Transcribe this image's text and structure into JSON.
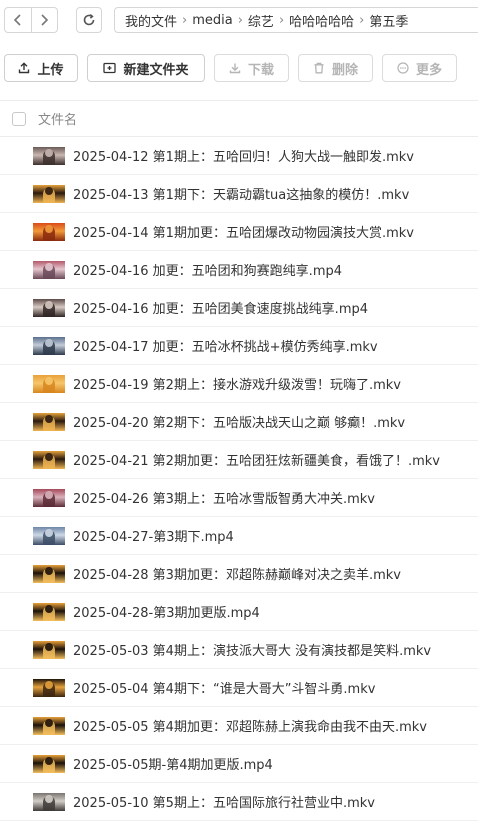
{
  "nav": {
    "back_icon": "chevron-left-icon",
    "forward_icon": "chevron-right-icon",
    "refresh_icon": "refresh-icon"
  },
  "breadcrumb": [
    "我的文件",
    "media",
    "综艺",
    "哈哈哈哈哈",
    "第五季"
  ],
  "toolbar": {
    "upload": "上传",
    "new_folder": "新建文件夹",
    "download": "下载",
    "delete": "删除",
    "more": "更多"
  },
  "list_header": {
    "name": "文件名"
  },
  "files": [
    {
      "name": "2025-04-12 第1期上：五哈回归！人狗大战一触即发.mkv",
      "thumb": [
        "#6b5a55",
        "#c9b7b2",
        "#3c2f2c"
      ]
    },
    {
      "name": "2025-04-13 第1期下：天霸动霸tua这抽象的模仿！.mkv",
      "thumb": [
        "#e6a23c",
        "#2b1a0f",
        "#f0b552"
      ]
    },
    {
      "name": "2025-04-14 第1期加更：五哈团爆改动物园演技大赏.mkv",
      "thumb": [
        "#d94c1a",
        "#f39a3a",
        "#8a2a0e"
      ]
    },
    {
      "name": "2025-04-16 加更：五哈团和狗赛跑纯享.mp4",
      "thumb": [
        "#b4596b",
        "#e6c7cf",
        "#6a4a58"
      ]
    },
    {
      "name": "2025-04-16 加更：五哈团美食速度挑战纯享.mp4",
      "thumb": [
        "#5c4a48",
        "#d8c9c2",
        "#2f2524"
      ]
    },
    {
      "name": "2025-04-17 加更：五哈冰杯挑战+模仿秀纯享.mkv",
      "thumb": [
        "#5a6f8c",
        "#c3ccd8",
        "#2e3a4c"
      ]
    },
    {
      "name": "2025-04-19 第2期上：接水游戏升级泼雪！玩嗨了.mkv",
      "thumb": [
        "#e9a13a",
        "#f6c66a",
        "#d8861f"
      ]
    },
    {
      "name": "2025-04-20 第2期下：五哈版决战天山之巅 够癫！.mkv",
      "thumb": [
        "#e6a23c",
        "#2b1a0f",
        "#f0b552"
      ]
    },
    {
      "name": "2025-04-21 第2期加更：五哈团狂炫新疆美食，看饿了！.mkv",
      "thumb": [
        "#e6a23c",
        "#2b1a0f",
        "#f0b552"
      ]
    },
    {
      "name": "2025-04-26 第3期上：五哈冰雪版智勇大冲关.mkv",
      "thumb": [
        "#a5485a",
        "#dab1bb",
        "#5b2c36"
      ]
    },
    {
      "name": "2025-04-27-第3期下.mp4",
      "thumb": [
        "#6e86a6",
        "#cdd8e6",
        "#3c4d66"
      ]
    },
    {
      "name": "2025-04-28 第3期加更：邓超陈赫巅峰对决之卖羊.mkv",
      "thumb": [
        "#e9a13a",
        "#1c120a",
        "#f4be5c"
      ]
    },
    {
      "name": "2025-04-28-第3期加更版.mp4",
      "thumb": [
        "#e9a13a",
        "#1c120a",
        "#f4be5c"
      ]
    },
    {
      "name": "2025-05-03 第4期上：演技派大哥大 没有演技都是笑料.mkv",
      "thumb": [
        "#e9a13a",
        "#1c120a",
        "#f4be5c"
      ]
    },
    {
      "name": "2025-05-04 第4期下：“谁是大哥大”斗智斗勇.mkv",
      "thumb": [
        "#1e1208",
        "#e6a23c",
        "#3a2410"
      ]
    },
    {
      "name": "2025-05-05 第4期加更：邓超陈赫上演我命由我不由天.mkv",
      "thumb": [
        "#e9a13a",
        "#1c120a",
        "#f4be5c"
      ]
    },
    {
      "name": "2025-05-05期-第4期加更版.mp4",
      "thumb": [
        "#e9a13a",
        "#1c120a",
        "#f4be5c"
      ]
    },
    {
      "name": "2025-05-10 第5期上：五哈国际旅行社营业中.mkv",
      "thumb": [
        "#7a7470",
        "#d4cec9",
        "#3e3a37"
      ]
    }
  ]
}
